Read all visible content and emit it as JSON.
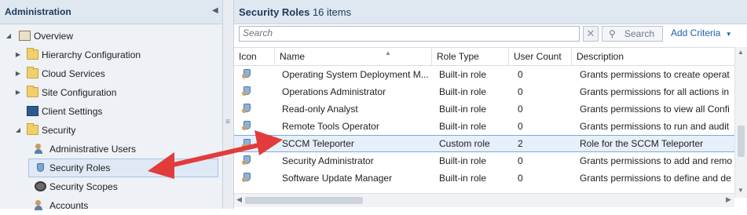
{
  "nav": {
    "title": "Administration",
    "collapse_icon": "chevron-left-icon",
    "items": [
      {
        "label": "Overview",
        "icon": "overview-icon",
        "expander": "◢"
      },
      {
        "label": "Hierarchy Configuration",
        "icon": "folder-icon",
        "expander": "▶"
      },
      {
        "label": "Cloud Services",
        "icon": "folder-icon",
        "expander": "▶"
      },
      {
        "label": "Site Configuration",
        "icon": "folder-icon",
        "expander": "▶"
      },
      {
        "label": "Client Settings",
        "icon": "monitor-icon",
        "expander": ""
      },
      {
        "label": "Security",
        "icon": "folder-icon",
        "expander": "◢"
      },
      {
        "label": "Administrative Users",
        "icon": "users-icon",
        "expander": ""
      },
      {
        "label": "Security Roles",
        "icon": "role-icon",
        "expander": ""
      },
      {
        "label": "Security Scopes",
        "icon": "scope-icon",
        "expander": ""
      },
      {
        "label": "Accounts",
        "icon": "users-icon",
        "expander": ""
      }
    ]
  },
  "content": {
    "title": "Security Roles",
    "count": "16 items",
    "search_placeholder": "Search",
    "clear_label": "✕",
    "search_button": "Search",
    "add_criteria": "Add Criteria",
    "add_criteria_arrow": "▼",
    "columns": [
      "Icon",
      "Name",
      "Role Type",
      "User Count",
      "Description"
    ],
    "rows": [
      {
        "name": "Operating System Deployment M...",
        "type": "Built-in role",
        "count": "0",
        "desc": "Grants permissions to create operat"
      },
      {
        "name": "Operations Administrator",
        "type": "Built-in role",
        "count": "0",
        "desc": "Grants permissions for all actions in"
      },
      {
        "name": "Read-only Analyst",
        "type": "Built-in role",
        "count": "0",
        "desc": "Grants permissions to view all Confi"
      },
      {
        "name": "Remote Tools Operator",
        "type": "Built-in role",
        "count": "0",
        "desc": "Grants permissions to run and audit"
      },
      {
        "name": "SCCM Teleporter",
        "type": "Custom role",
        "count": "2",
        "desc": "Role for the SCCM Teleporter"
      },
      {
        "name": "Security Administrator",
        "type": "Built-in role",
        "count": "0",
        "desc": "Grants permissions to add and remo"
      },
      {
        "name": "Software Update Manager",
        "type": "Built-in role",
        "count": "0",
        "desc": "Grants permissions to define and de"
      }
    ],
    "selected_row": 4
  },
  "colors": {
    "accent_arrow": "#e23b3b",
    "selection": "#e6effa",
    "header_bg": "#dfe7f0"
  }
}
